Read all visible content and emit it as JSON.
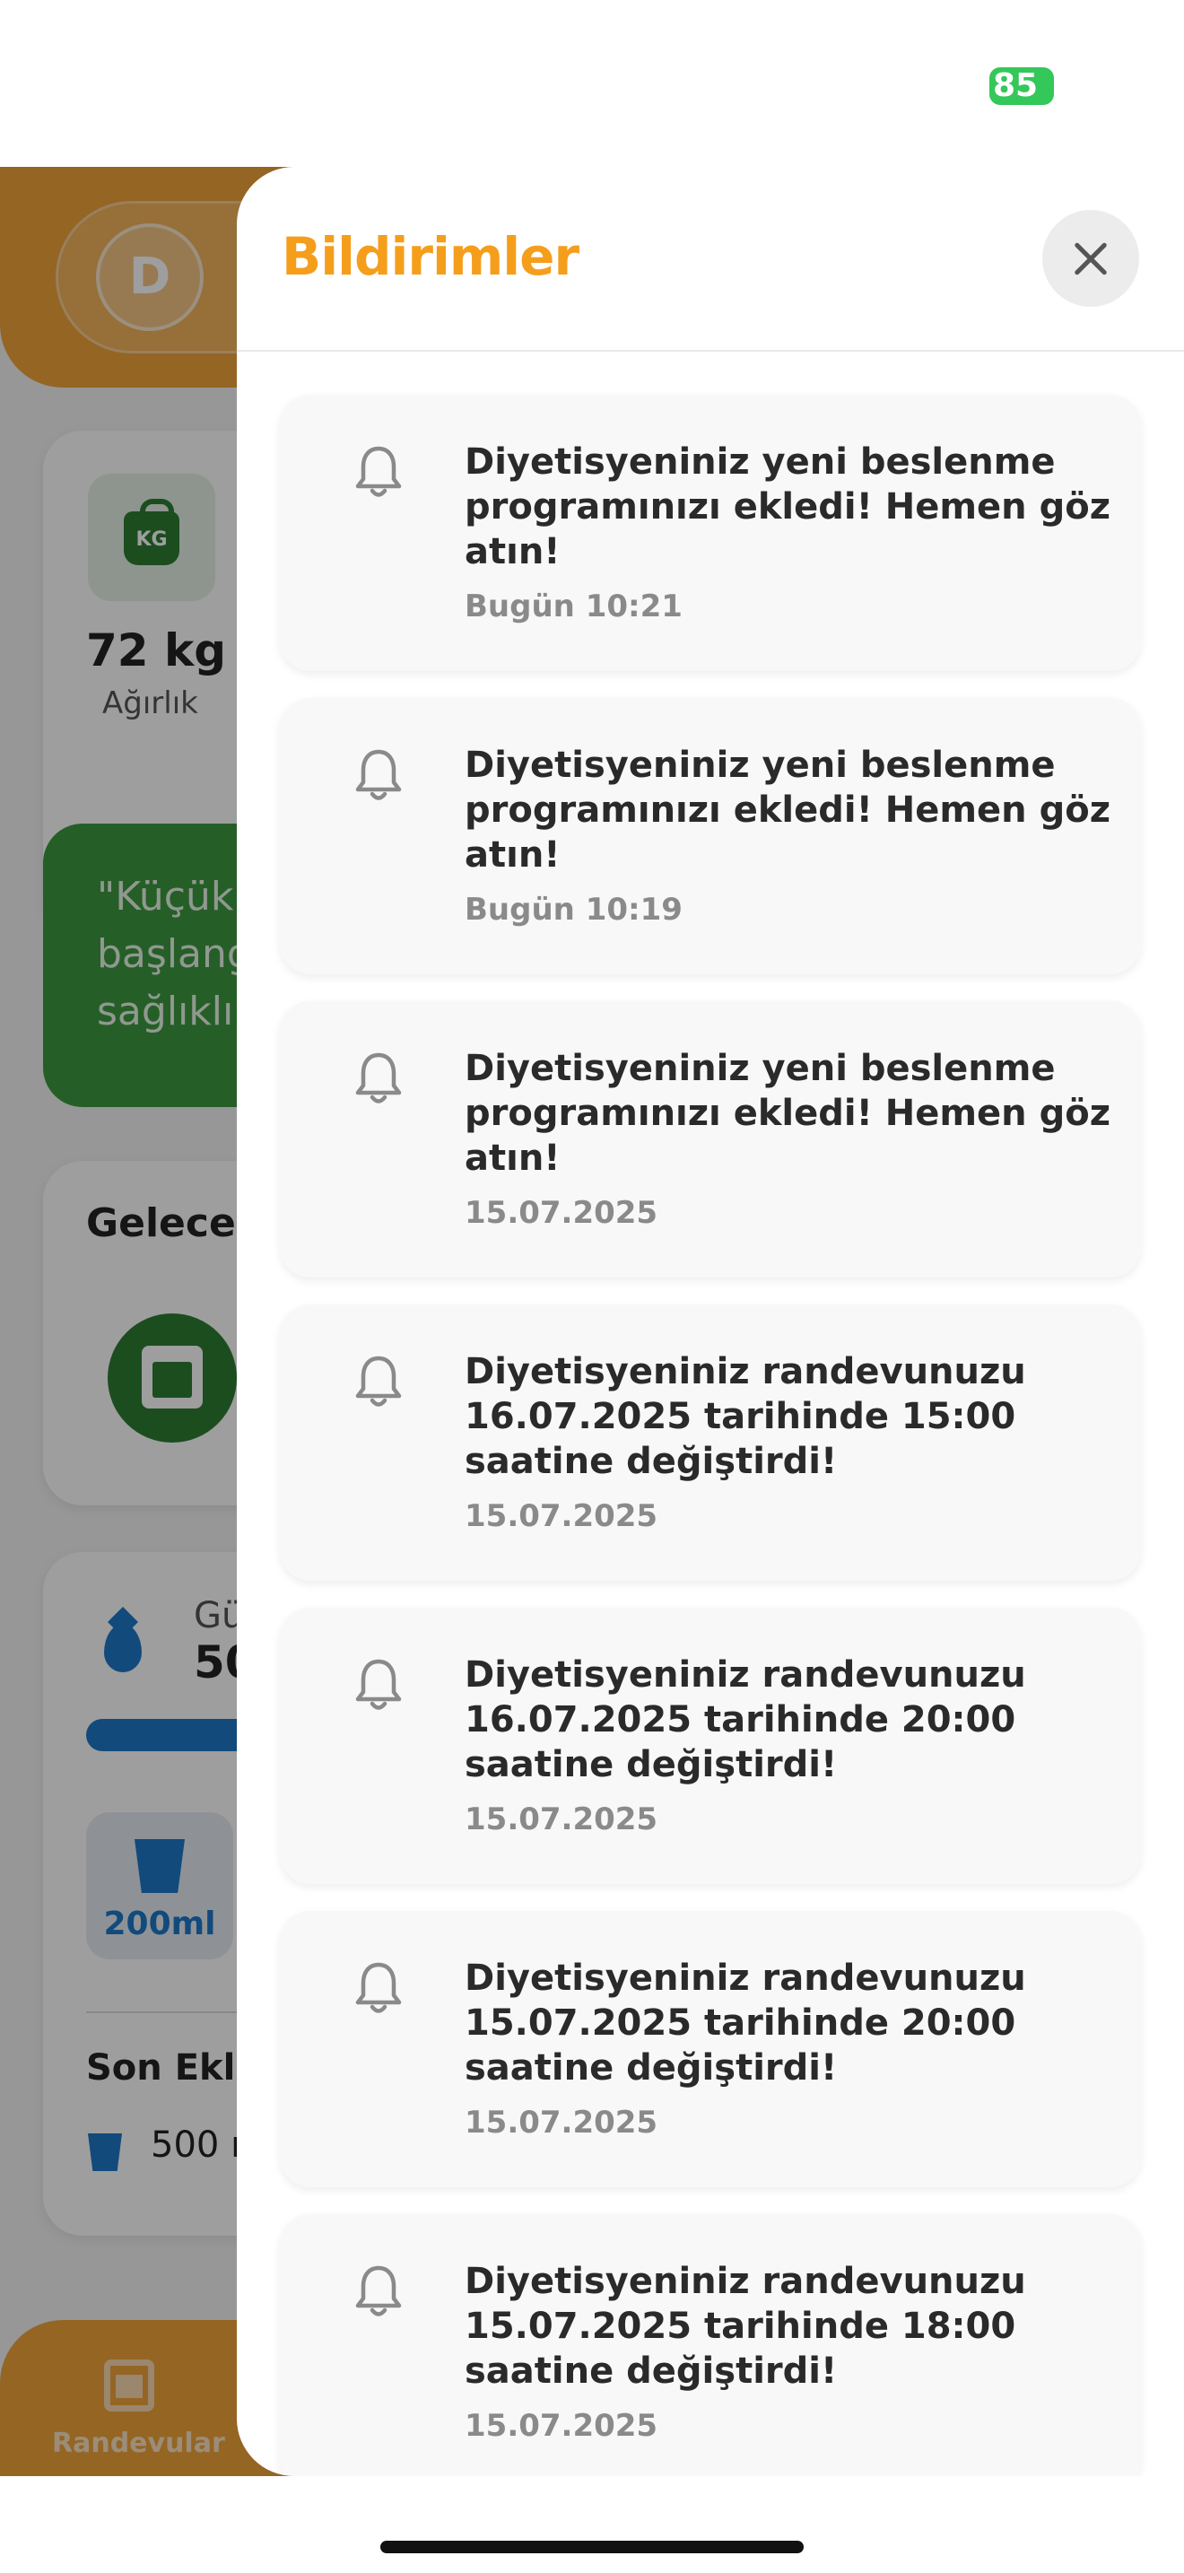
{
  "status_bar": {
    "battery": "85"
  },
  "background_app": {
    "avatar_initial": "D",
    "weight_value": "72 kg",
    "weight_label": "Ağırlık",
    "quote_text": "\"Küçük\nbaşlang\nsağlıklı",
    "upcoming_title": "Gelecek",
    "water_label_partial": "Gü",
    "water_value_partial": "50",
    "cup_label": "200ml",
    "recent_title": "Son Ekle",
    "recent_item": "500 m",
    "nav_label": "Randevular"
  },
  "sheet": {
    "title": "Bildirimler",
    "notifications": [
      {
        "message": "Diyetisyeniniz yeni beslenme programınızı ekledi! Hemen göz atın!",
        "time": "Bugün 10:21"
      },
      {
        "message": "Diyetisyeniniz yeni beslenme programınızı ekledi! Hemen göz atın!",
        "time": "Bugün 10:19"
      },
      {
        "message": "Diyetisyeniniz yeni beslenme programınızı ekledi! Hemen göz atın!",
        "time": "15.07.2025"
      },
      {
        "message": "Diyetisyeniniz randevunuzu 16.07.2025 tarihinde 15:00 saatine değiştirdi!",
        "time": "15.07.2025"
      },
      {
        "message": "Diyetisyeniniz randevunuzu 16.07.2025 tarihinde 20:00 saatine değiştirdi!",
        "time": "15.07.2025"
      },
      {
        "message": "Diyetisyeniniz randevunuzu 15.07.2025 tarihinde 20:00 saatine değiştirdi!",
        "time": "15.07.2025"
      },
      {
        "message": "Diyetisyeniniz randevunuzu 15.07.2025 tarihinde 18:00 saatine değiştirdi!",
        "time": "15.07.2025"
      }
    ]
  },
  "icons": {
    "close": "close-icon",
    "notification": "bell-icon",
    "weight": "kg-weight-icon",
    "calendar": "calendar-icon",
    "water": "water-drop-icon",
    "cup": "cup-icon"
  },
  "colors": {
    "accent_orange": "#f59e1c",
    "header_orange": "#f0a33a",
    "green": "#2e7d32",
    "blue": "#1e78c8",
    "battery_green": "#34c759"
  }
}
